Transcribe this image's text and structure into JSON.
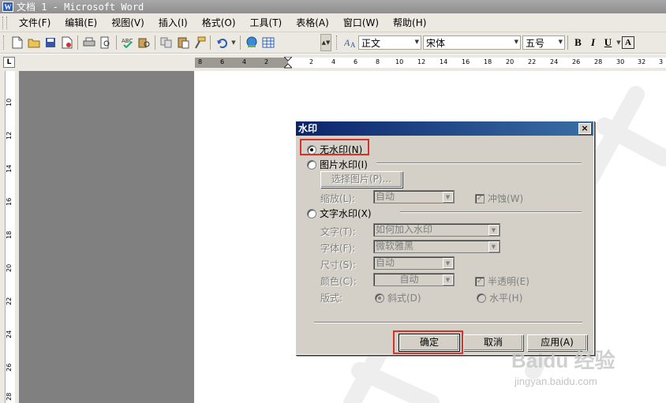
{
  "window": {
    "title": "文档 1 - Microsoft Word",
    "icon": "word-doc-icon"
  },
  "menubar": {
    "items": [
      "文件(F)",
      "编辑(E)",
      "视图(V)",
      "插入(I)",
      "格式(O)",
      "工具(T)",
      "表格(A)",
      "窗口(W)",
      "帮助(H)"
    ]
  },
  "toolbar": {
    "style_value": "正文",
    "font_value": "宋体",
    "size_value": "五号",
    "bold": "B",
    "italic": "I",
    "underline": "U",
    "font_color": "A",
    "style_icon_label": "A"
  },
  "ruler": {
    "corner": "L",
    "h_left_ticks": [
      "8",
      "6",
      "4",
      "2"
    ],
    "h_right_ticks": [
      "2",
      "4",
      "6",
      "8",
      "10",
      "12",
      "14",
      "16",
      "18",
      "20",
      "22",
      "24",
      "26",
      "28",
      "30",
      "32",
      "3"
    ],
    "v_ticks": [
      "10",
      "12",
      "14",
      "16",
      "18",
      "20",
      "22",
      "24",
      "26",
      "28"
    ]
  },
  "dialog": {
    "title": "水印",
    "close": "×",
    "no_watermark": "无水印(N)",
    "picture_watermark": "图片水印(I)",
    "select_picture": "选择图片(P)...",
    "scale_label": "缩放(L):",
    "scale_value": "自动",
    "washout_label": "冲蚀(W)",
    "text_watermark": "文字水印(X)",
    "text_label": "文字(T):",
    "text_value": "如何加入水印",
    "font_label": "字体(F):",
    "font_value": "微软雅黑",
    "size_label": "尺寸(S):",
    "size_value": "自动",
    "color_label": "颜色(C):",
    "color_value": "自动",
    "semitransparent_label": "半透明(E)",
    "layout_label": "版式:",
    "diagonal_label": "斜式(D)",
    "horizontal_label": "水平(H)",
    "ok": "确定",
    "cancel": "取消",
    "apply": "应用(A)"
  },
  "overlay": {
    "brand": "Baidu 经验",
    "brand_url": "jingyan.baidu.com"
  },
  "colors": {
    "highlight": "#d9302a",
    "dialog_title_start": "#0a246a",
    "dialog_title_end": "#3a6ea5",
    "dialog_bg": "#d4d0c8"
  }
}
